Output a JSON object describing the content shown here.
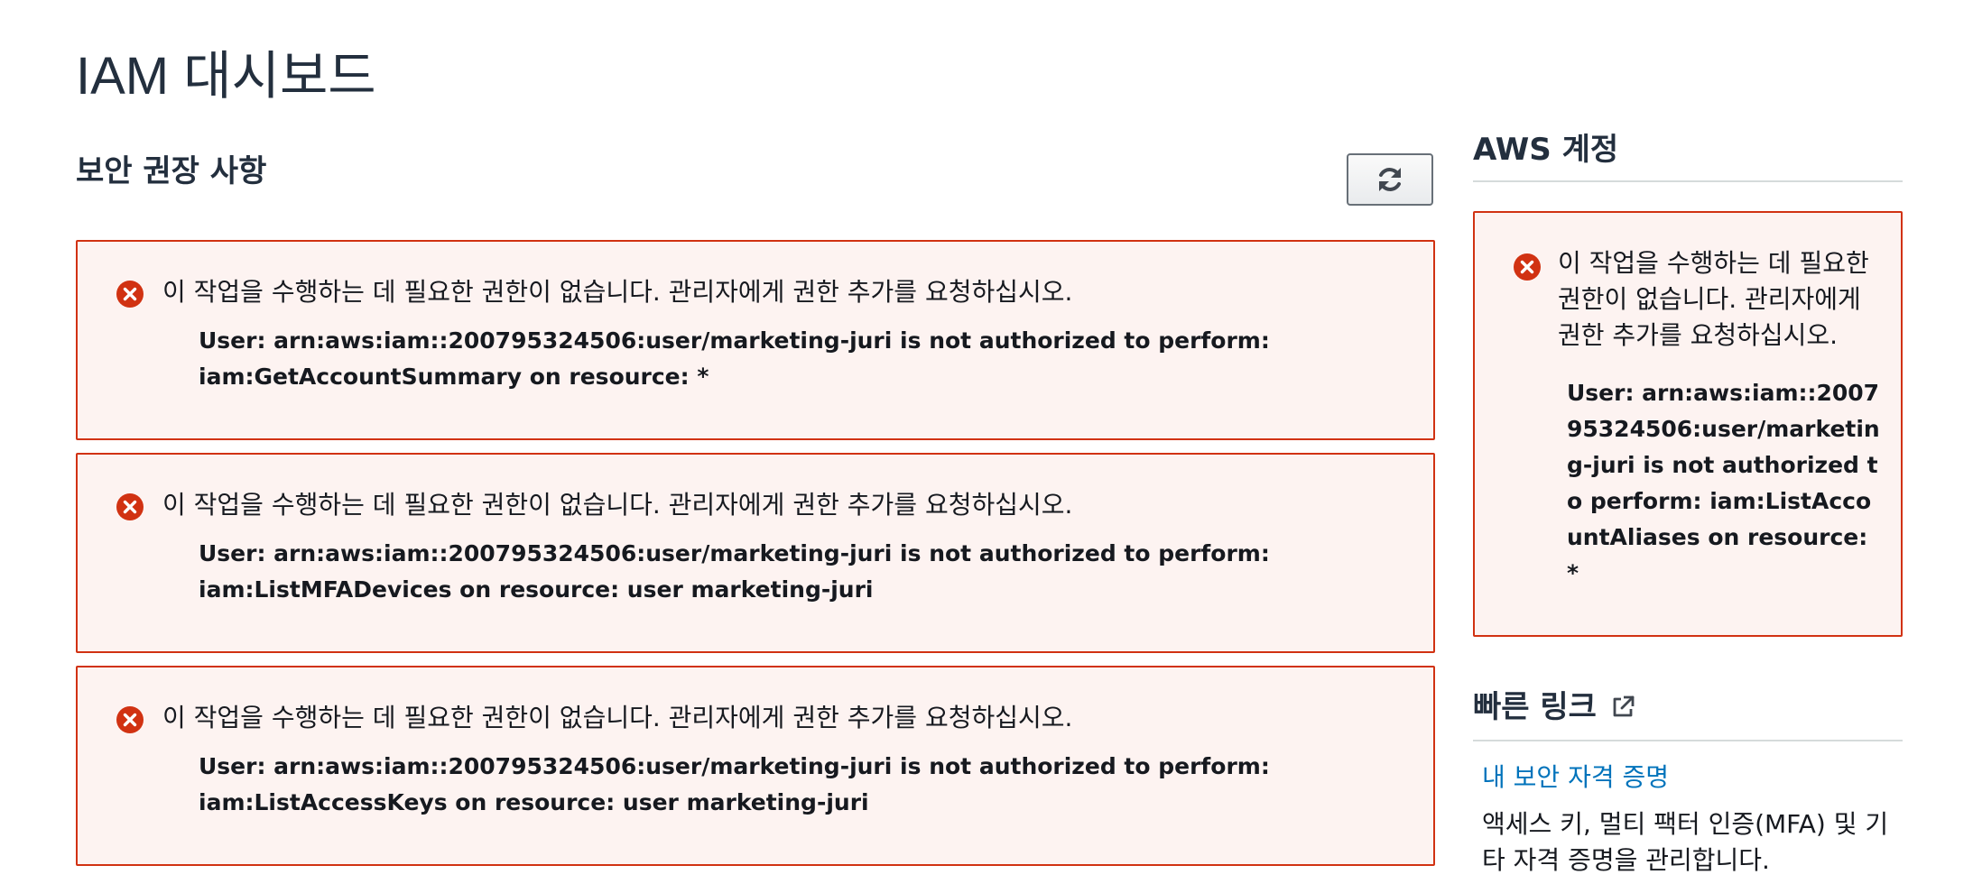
{
  "page": {
    "title": "IAM 대시보드"
  },
  "security_recommendations": {
    "title": "보안 권장 사항",
    "refresh_icon": "refresh-icon",
    "alerts": [
      {
        "icon": "error-icon",
        "message": "이 작업을 수행하는 데 필요한 권한이 없습니다. 관리자에게 권한 추가를 요청하십시오.",
        "detail": "User: arn:aws:iam::200795324506:user/marketing-juri is not authorized to perform: iam:GetAccountSummary on resource: *"
      },
      {
        "icon": "error-icon",
        "message": "이 작업을 수행하는 데 필요한 권한이 없습니다. 관리자에게 권한 추가를 요청하십시오.",
        "detail": "User: arn:aws:iam::200795324506:user/marketing-juri is not authorized to perform: iam:ListMFADevices on resource: user marketing-juri"
      },
      {
        "icon": "error-icon",
        "message": "이 작업을 수행하는 데 필요한 권한이 없습니다. 관리자에게 권한 추가를 요청하십시오.",
        "detail": "User: arn:aws:iam::200795324506:user/marketing-juri is not authorized to perform: iam:ListAccessKeys on resource: user marketing-juri"
      }
    ]
  },
  "aws_account": {
    "title": "AWS 계정",
    "alert": {
      "icon": "error-icon",
      "message": "이 작업을 수행하는 데 필요한 권한이 없습니다. 관리자에게 권한 추가를 요청하십시오.",
      "detail": "User: arn:aws:iam::200795324506:user/marketing-juri is not authorized to perform: iam:ListAccountAliases on resource: *"
    }
  },
  "quick_links": {
    "title": "빠른 링크",
    "title_icon": "external-link-icon",
    "link_label": "내 보안 자격 증명",
    "link_description": "액세스 키, 멀티 팩터 인증(MFA) 및 기타 자격 증명을 관리합니다."
  },
  "colors": {
    "error_border": "#d13212",
    "error_background": "#fdf3f1",
    "error_icon": "#d13212",
    "link": "#0073bb",
    "heading": "#232f3e"
  }
}
